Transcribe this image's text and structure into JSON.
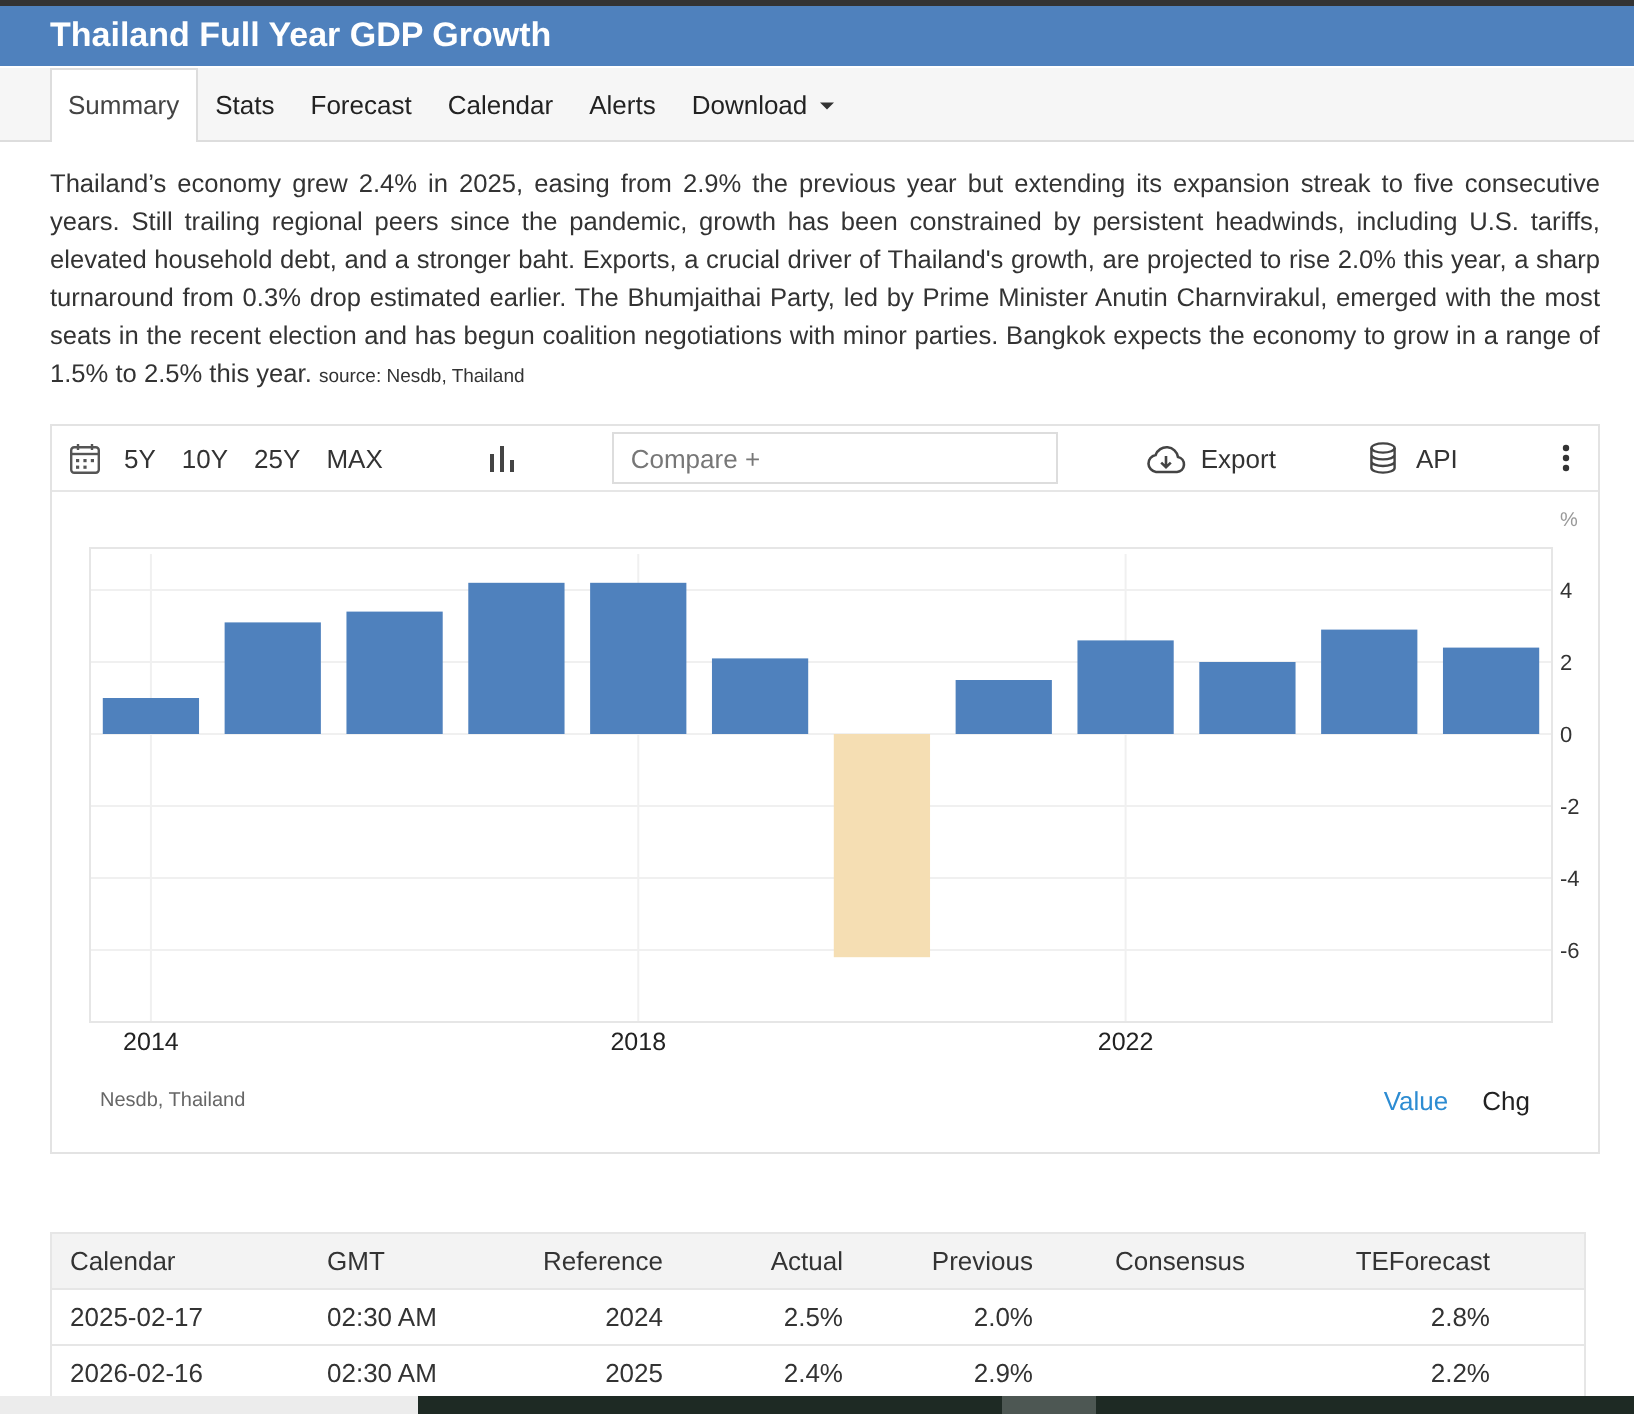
{
  "header": {
    "title": "Thailand Full Year GDP Growth"
  },
  "tabs": [
    {
      "label": "Summary",
      "kind": "link",
      "selected": true
    },
    {
      "label": "Stats",
      "kind": "link",
      "selected": false
    },
    {
      "label": "Forecast",
      "kind": "link",
      "selected": false
    },
    {
      "label": "Calendar",
      "kind": "link",
      "selected": false
    },
    {
      "label": "Alerts",
      "kind": "link",
      "selected": false
    },
    {
      "label": "Download",
      "kind": "dropdown",
      "selected": false
    }
  ],
  "summary": {
    "text": "Thailand’s economy grew 2.4% in 2025, easing from 2.9% the previous year but extending its expansion streak to five consecutive years. Still trailing regional peers since the pandemic, growth has been constrained by persistent headwinds, including U.S. tariffs, elevated household debt, and a stronger baht. Exports, a crucial driver of Thailand's growth, are projected to rise 2.0% this year, a sharp turnaround from 0.3% drop estimated earlier. The Bhumjaithai Party, led by Prime Minister Anutin Charnvirakul, emerged with the most seats in the recent election and has begun coalition negotiations with minor parties. Bangkok expects the economy to grow in a range of 1.5% to 2.5% this year.",
    "source": "source: Nesdb, Thailand"
  },
  "chart": {
    "toolbar": {
      "ranges": [
        "5Y",
        "10Y",
        "25Y",
        "MAX"
      ],
      "compare": {
        "placeholder": "Compare +"
      },
      "export": "Export",
      "api": "API"
    },
    "chart_data": {
      "type": "bar",
      "ylabel": "%",
      "x": [
        2014,
        2015,
        2016,
        2017,
        2018,
        2019,
        2020,
        2021,
        2022,
        2023,
        2024,
        2025
      ],
      "series": [
        {
          "color": "#4f81bd",
          "values": [
            1.0,
            3.1,
            3.4,
            4.2,
            4.2,
            2.1,
            null,
            1.5,
            2.6,
            2.0,
            2.9,
            2.4
          ]
        },
        {
          "color": "#f5deb3",
          "values": [
            null,
            null,
            null,
            null,
            null,
            null,
            -6.2,
            null,
            null,
            null,
            null,
            null
          ]
        }
      ],
      "stacked": true,
      "grid": true,
      "xlim": [
        2013.5,
        2025.5
      ],
      "xticks": [
        2014,
        2018,
        2022
      ],
      "yticks": [
        -6,
        -4,
        -2,
        0,
        2,
        4
      ],
      "ylim": [
        -8,
        5
      ]
    },
    "source": "Nesdb, Thailand",
    "views": [
      {
        "label": "Value",
        "selected": true
      },
      {
        "label": "Chg",
        "selected": false
      }
    ]
  },
  "table": {
    "columns": [
      "Calendar",
      "GMT",
      "Reference",
      "Actual",
      "Previous",
      "Consensus",
      "TEForecast"
    ],
    "rows": [
      {
        "calendar": "2025-02-17",
        "gmt": "02:30 AM",
        "reference": "2024",
        "actual": "2.5%",
        "previous": "2.0%",
        "teforecast": "2.8%"
      },
      {
        "calendar": "2026-02-16",
        "gmt": "02:30 AM",
        "reference": "2025",
        "actual": "2.4%",
        "previous": "2.9%",
        "teforecast": "2.2%"
      }
    ]
  }
}
